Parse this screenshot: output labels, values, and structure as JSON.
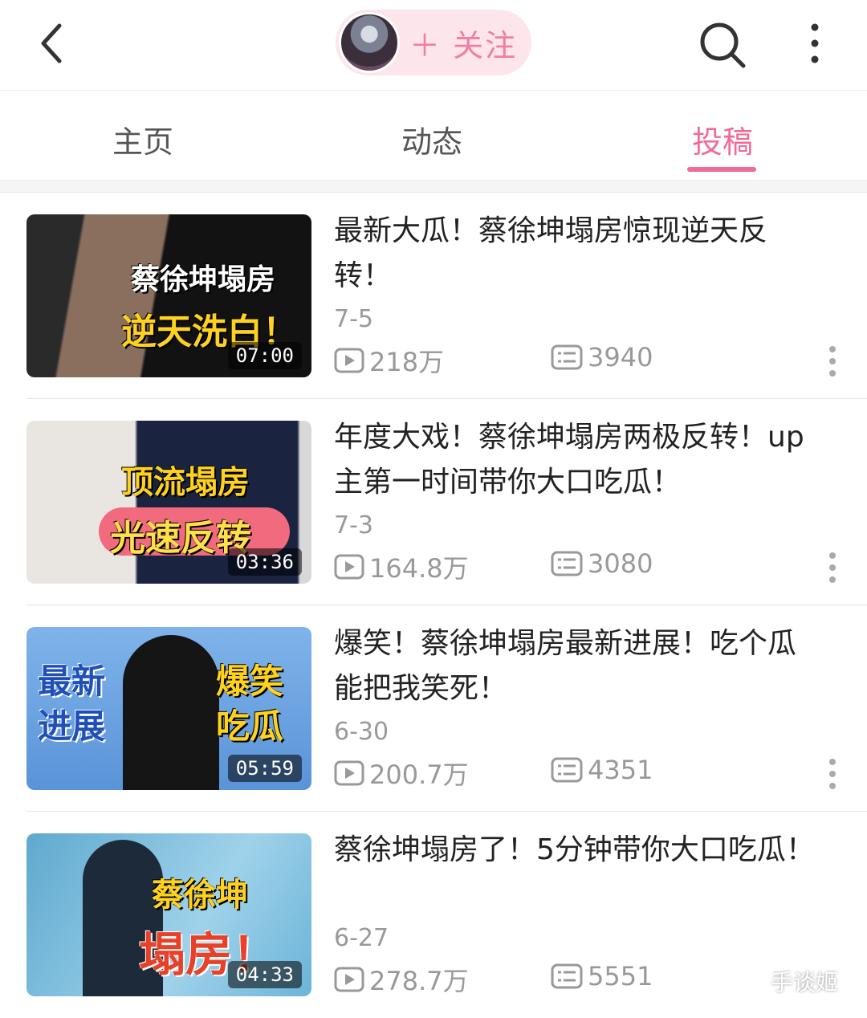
{
  "header": {
    "follow_label": "＋ 关注"
  },
  "tabs": [
    "主页",
    "动态",
    "投稿"
  ],
  "videos": [
    {
      "thumb_caption_1": "蔡徐坤塌房",
      "thumb_caption_2": "逆天洗白！",
      "duration": "07:00",
      "title": "最新大瓜！蔡徐坤塌房惊现逆天反转！",
      "date": "7-5",
      "views": "218万",
      "comments": "3940"
    },
    {
      "thumb_caption_1": "顶流塌房",
      "thumb_caption_2": "光速反转",
      "duration": "03:36",
      "title": "年度大戏！蔡徐坤塌房两极反转！up主第一时间带你大口吃瓜！",
      "date": "7-3",
      "views": "164.8万",
      "comments": "3080"
    },
    {
      "thumb_caption_1": "最新 进展",
      "thumb_caption_2": "爆笑 吃瓜",
      "duration": "05:59",
      "title": "爆笑！蔡徐坤塌房最新进展！吃个瓜能把我笑死！",
      "date": "6-30",
      "views": "200.7万",
      "comments": "4351"
    },
    {
      "thumb_caption_1": "蔡徐坤",
      "thumb_caption_2": "塌房！",
      "duration": "04:33",
      "title": "蔡徐坤塌房了！5分钟带你大口吃瓜！",
      "date": "6-27",
      "views": "278.7万",
      "comments": "5551"
    }
  ],
  "watermark": "手谈姬",
  "colors": {
    "accent": "#f06b95",
    "follow_bg": "#fde5ec"
  }
}
